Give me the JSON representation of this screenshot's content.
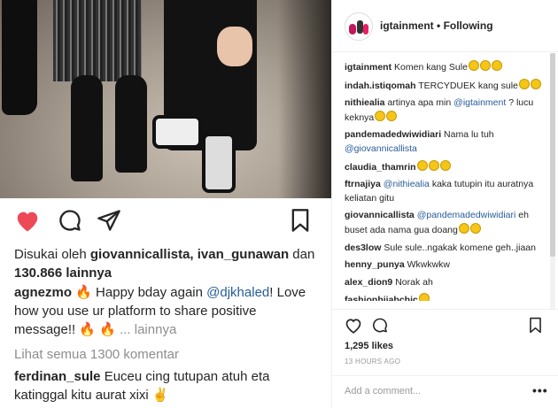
{
  "left": {
    "liked_by_prefix": "Disukai oleh",
    "liked_by_names": "giovannicallista, ivan_gunawan",
    "liked_by_and": "dan",
    "liked_by_count": "130.866 lainnya",
    "caption_user": "agnezmo",
    "caption_pre": "Happy bday again",
    "caption_mention": "@djkhaled",
    "caption_post": "! Love how you use ur platform to share positive message!!",
    "caption_more": "... lainnya",
    "view_all": "Lihat semua 1300 komentar",
    "comment_user": "ferdinan_sule",
    "comment_text": "Euceu cing tutupan atuh eta katinggal kitu aurat xixi"
  },
  "right": {
    "header_user": "igtainment",
    "header_sep": "•",
    "header_follow": "Following",
    "comments": [
      {
        "user": "igtainment",
        "pre": "Komen kang Sule",
        "mention": "",
        "post": "",
        "emoji": 3
      },
      {
        "user": "indah.istiqomah",
        "pre": "TERCYDUEK kang sule",
        "mention": "",
        "post": "",
        "emoji": 2
      },
      {
        "user": "nithiealia",
        "pre": "artinya apa min",
        "mention": "@igtainment",
        "post": "? lucu keknya",
        "emoji": 2
      },
      {
        "user": "pandemadedwiwidiari",
        "pre": "Nama lu tuh",
        "mention": "@giovannicallista",
        "post": "",
        "emoji": 0
      },
      {
        "user": "claudia_thamrin",
        "pre": "",
        "mention": "",
        "post": "",
        "emoji": 3
      },
      {
        "user": "ftrnajiya",
        "pre": "",
        "mention": "@nithiealia",
        "post": "kaka tutupin itu auratnya keliatan gitu",
        "emoji": 0
      },
      {
        "user": "giovannicallista",
        "pre": "",
        "mention": "@pandemadedwiwidiari",
        "post": "eh buset ada nama gua doang",
        "emoji": 2
      },
      {
        "user": "des3low",
        "pre": "Sule sule..ngakak komene geh..jiaan",
        "mention": "",
        "post": "",
        "emoji": 0
      },
      {
        "user": "henny_punya",
        "pre": "Wkwkwkw",
        "mention": "",
        "post": "",
        "emoji": 0
      },
      {
        "user": "alex_dion9",
        "pre": "Norak ah",
        "mention": "",
        "post": "",
        "emoji": 0
      },
      {
        "user": "fashionhijabchic",
        "pre": "",
        "mention": "",
        "post": "",
        "emoji": 1
      }
    ],
    "likes": "1,295 likes",
    "time": "13 HOURS AGO",
    "add_comment": "Add a comment...",
    "more": "•••"
  },
  "colors": {
    "heart": "#ed4956",
    "mention": "#275c9a",
    "muted": "#8e8e8e"
  },
  "icons": [
    "heart-icon",
    "comment-icon",
    "share-icon",
    "bookmark-icon",
    "more-icon"
  ]
}
